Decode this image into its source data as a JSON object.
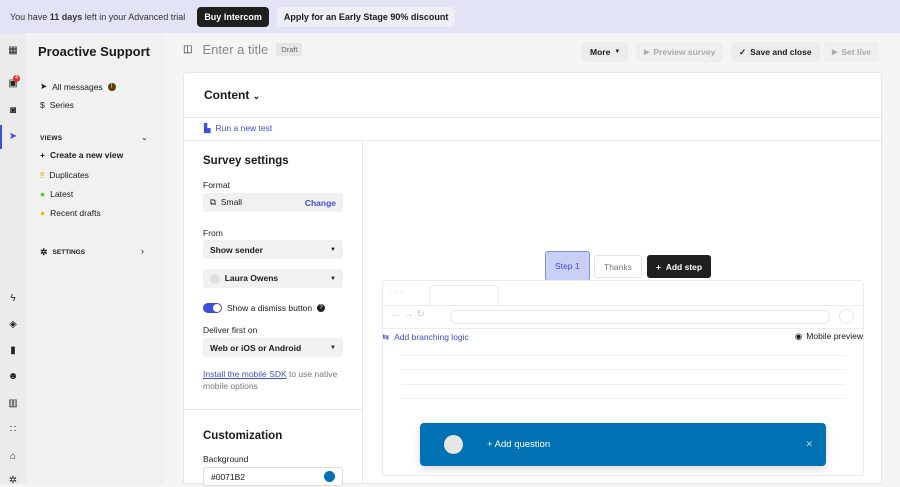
{
  "banner": {
    "pre": "You have ",
    "days": "11 days",
    "post": " left in your Advanced trial",
    "buy": "Buy Intercom",
    "discount": "Apply for an Early Stage 90% discount"
  },
  "sidebar": {
    "title": "Proactive Support",
    "all_messages": "All messages",
    "series": "Series",
    "views": "VIEWS",
    "create_view": "Create a new view",
    "duplicates": "Duplicates",
    "latest": "Latest",
    "recent_drafts": "Recent drafts",
    "settings": "SETTINGS",
    "inbox_badge": "4"
  },
  "header": {
    "title_placeholder": "Enter a title",
    "status": "Draft",
    "more": "More",
    "preview": "Preview survey",
    "save": "Save and close",
    "set_live": "Set live"
  },
  "content": {
    "heading": "Content",
    "run_test": "Run a new test"
  },
  "settings": {
    "heading": "Survey settings",
    "format_label": "Format",
    "format_value": "Small",
    "change": "Change",
    "from_label": "From",
    "from_value": "Show sender",
    "sender": "Laura Owens",
    "dismiss": "Show a dismiss button",
    "deliver_label": "Deliver first on",
    "deliver_value": "Web or iOS or Android",
    "sdk_link": "Install the mobile SDK",
    "sdk_rest": " to use native mobile options",
    "customization": "Customization",
    "background_label": "Background",
    "background_value": "#0071B2"
  },
  "preview": {
    "step1": "Step 1",
    "thanks": "Thanks",
    "add_step": "Add step",
    "branching": "Add branching logic",
    "mobile_preview": "Mobile preview",
    "add_question": "+ Add question"
  },
  "colors": {
    "accent": "#3c4fd6",
    "survey_bg": "#0071B2"
  }
}
